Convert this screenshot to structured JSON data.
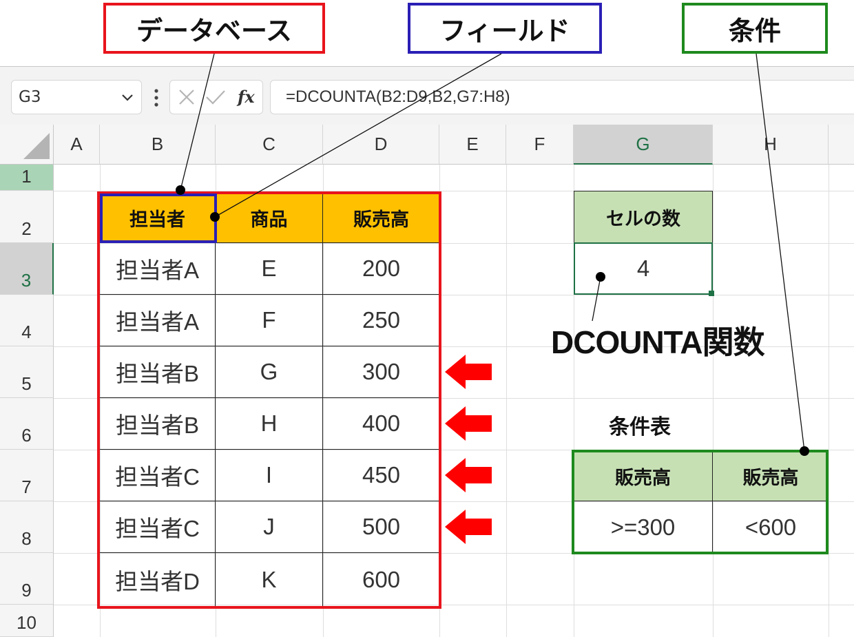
{
  "callouts": {
    "database": "データベース",
    "field": "フィールド",
    "criteria": "条件",
    "function_label": "DCOUNTA関数",
    "criteria_table_title": "条件表"
  },
  "colors": {
    "database_box": "#e8141c",
    "field_box": "#2a1fb5",
    "criteria_box": "#1e8a1e",
    "header_fill": "#ffc000",
    "green_fill": "#c6e0b4",
    "arrow": "#ff0000",
    "selection": "#1e7145"
  },
  "formula_bar": {
    "name_box": "G3",
    "formula": "=DCOUNTA(B2:D9,B2,G7:H8)",
    "icons": [
      "chevron-down-icon",
      "more-options-icon",
      "cancel-icon",
      "enter-icon",
      "function-icon"
    ]
  },
  "sheet": {
    "columns": [
      "A",
      "B",
      "C",
      "D",
      "E",
      "F",
      "G",
      "H"
    ],
    "rows": [
      "1",
      "2",
      "3",
      "4",
      "5",
      "6",
      "7",
      "8",
      "9",
      "10"
    ],
    "selected_cell": "G3"
  },
  "database_table": {
    "headers": [
      "担当者",
      "商品",
      "販売高"
    ],
    "rows": [
      [
        "担当者A",
        "E",
        "200"
      ],
      [
        "担当者A",
        "F",
        "250"
      ],
      [
        "担当者B",
        "G",
        "300"
      ],
      [
        "担当者B",
        "H",
        "400"
      ],
      [
        "担当者C",
        "I",
        "450"
      ],
      [
        "担当者C",
        "J",
        "500"
      ],
      [
        "担当者D",
        "K",
        "600"
      ]
    ]
  },
  "result": {
    "header": "セルの数",
    "value": "4"
  },
  "criteria_table": {
    "headers": [
      "販売高",
      "販売高"
    ],
    "values": [
      ">=300",
      "<600"
    ]
  }
}
